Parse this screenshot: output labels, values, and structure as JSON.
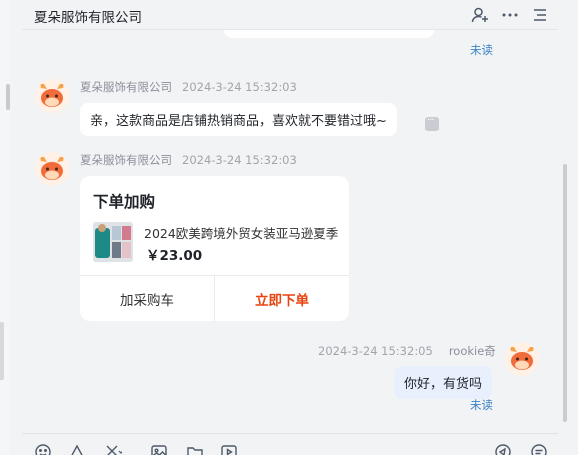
{
  "header": {
    "title": "夏朵服饰有限公司",
    "icons": [
      "add-user-icon",
      "more-icon",
      "menu-icon"
    ]
  },
  "chat": {
    "prev_status": "未读",
    "messages": [
      {
        "sender": "夏朵服饰有限公司",
        "time": "2024-3-24 15:32:03",
        "text": "亲，这款商品是店铺热销商品，喜欢就不要错过哦~"
      },
      {
        "sender": "夏朵服饰有限公司",
        "time": "2024-3-24 15:32:03",
        "card": {
          "title": "下单加购",
          "product_name": "2024欧美跨境外贸女装亚马逊夏季",
          "price": "￥23.00",
          "btn_cart": "加采购车",
          "btn_buy": "立即下单"
        }
      },
      {
        "sender": "rookie奇",
        "time": "2024-3-24 15:32:05",
        "text": "你好，有货吗",
        "status": "未读"
      }
    ]
  },
  "toolbar": {
    "icons": [
      "emoji-icon",
      "shape-icon",
      "scissors-icon",
      "image-icon",
      "folder-icon",
      "video-icon",
      "send-icon",
      "history-icon"
    ]
  },
  "colors": {
    "accent_unread": "#3b82c4",
    "buy_button": "#e8430e",
    "my_bubble": "#e8f0fd"
  }
}
